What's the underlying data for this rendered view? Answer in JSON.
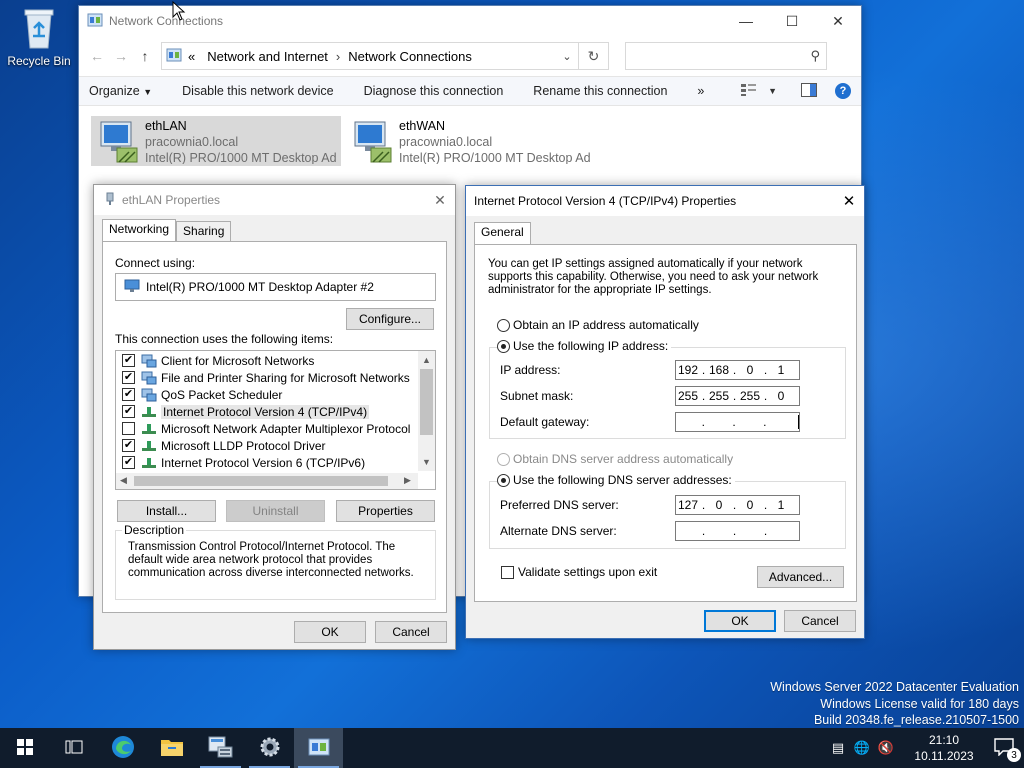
{
  "desktop": {
    "recycle_bin_label": "Recycle Bin"
  },
  "network_connections": {
    "title": "Network Connections",
    "breadcrumb": [
      "Network and Internet",
      "Network Connections"
    ],
    "breadcrumb_prefix": "«",
    "search_placeholder": "",
    "commands": [
      "Organize",
      "Disable this network device",
      "Diagnose this connection",
      "Rename this connection"
    ],
    "more_chevron": "»",
    "adapters": [
      {
        "name": "ethLAN",
        "domain": "pracownia0.local",
        "device": "Intel(R) PRO/1000 MT Desktop Ad..."
      },
      {
        "name": "ethWAN",
        "domain": "pracownia0.local",
        "device": "Intel(R) PRO/1000 MT Desktop Ad..."
      }
    ]
  },
  "eth_props": {
    "title": "ethLAN Properties",
    "tabs": [
      "Networking",
      "Sharing"
    ],
    "connect_using_label": "Connect using:",
    "adapter_name": "Intel(R) PRO/1000 MT Desktop Adapter #2",
    "configure_label": "Configure...",
    "items_label": "This connection uses the following items:",
    "items": [
      {
        "label": "Client for Microsoft Networks",
        "checked": true
      },
      {
        "label": "File and Printer Sharing for Microsoft Networks",
        "checked": true
      },
      {
        "label": "QoS Packet Scheduler",
        "checked": true
      },
      {
        "label": "Internet Protocol Version 4 (TCP/IPv4)",
        "checked": true
      },
      {
        "label": "Microsoft Network Adapter Multiplexor Protocol",
        "checked": false
      },
      {
        "label": "Microsoft LLDP Protocol Driver",
        "checked": true
      },
      {
        "label": "Internet Protocol Version 6 (TCP/IPv6)",
        "checked": true
      }
    ],
    "install_label": "Install...",
    "uninstall_label": "Uninstall",
    "properties_label": "Properties",
    "description_title": "Description",
    "description_text": "Transmission Control Protocol/Internet Protocol. The default wide area network protocol that provides communication across diverse interconnected networks.",
    "ok_label": "OK",
    "cancel_label": "Cancel"
  },
  "ipv4": {
    "title": "Internet Protocol Version 4 (TCP/IPv4) Properties",
    "tab": "General",
    "intro": "You can get IP settings assigned automatically if your network supports this capability. Otherwise, you need to ask your network administrator for the appropriate IP settings.",
    "obtain_ip_auto": "Obtain an IP address automatically",
    "use_following_ip": "Use the following IP address:",
    "ip_label": "IP address:",
    "ip_value": [
      "192",
      "168",
      "0",
      "1"
    ],
    "subnet_label": "Subnet mask:",
    "subnet_value": [
      "255",
      "255",
      "255",
      "0"
    ],
    "gateway_label": "Default gateway:",
    "gateway_value": [
      "",
      "",
      "",
      ""
    ],
    "obtain_dns_auto": "Obtain DNS server address automatically",
    "use_following_dns": "Use the following DNS server addresses:",
    "preferred_dns_label": "Preferred DNS server:",
    "preferred_dns_value": [
      "127",
      "0",
      "0",
      "1"
    ],
    "alternate_dns_label": "Alternate DNS server:",
    "alternate_dns_value": [
      "",
      "",
      "",
      ""
    ],
    "validate_label": "Validate settings upon exit",
    "advanced_label": "Advanced...",
    "ok_label": "OK",
    "cancel_label": "Cancel"
  },
  "watermark": {
    "line1": "Windows Server 2022 Datacenter Evaluation",
    "line2": "Windows License valid for 180 days",
    "line3": "Build 20348.fe_release.210507-1500"
  },
  "taskbar": {
    "time": "21:10",
    "date": "10.11.2023",
    "notification_count": "3"
  }
}
